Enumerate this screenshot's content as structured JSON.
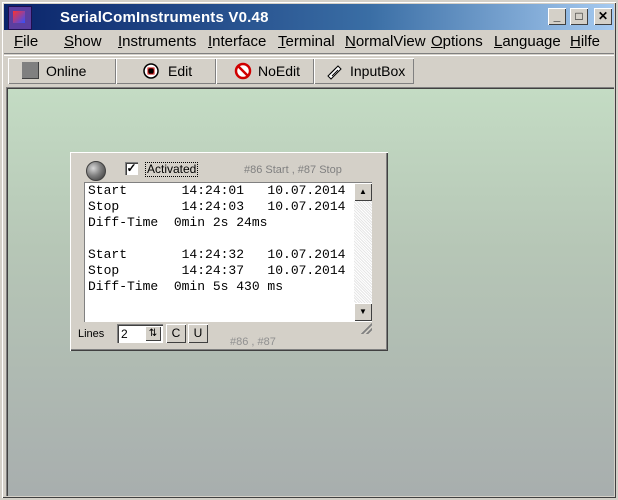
{
  "window": {
    "title": "SerialComInstruments  V0.48",
    "controls": {
      "minimize": "_",
      "maximize": "□",
      "close": "✕"
    }
  },
  "menu": [
    {
      "underline": "F",
      "rest": "ile"
    },
    {
      "underline": "S",
      "rest": "how"
    },
    {
      "underline": "I",
      "rest": "nstruments"
    },
    {
      "underline": "I",
      "rest": "nterface"
    },
    {
      "underline": "T",
      "rest": "erminal"
    },
    {
      "underline": "N",
      "rest": "ormalView"
    },
    {
      "underline": "O",
      "rest": "ptions"
    },
    {
      "underline": "L",
      "rest": "anguage"
    },
    {
      "underline": "H",
      "rest": "ilfe"
    }
  ],
  "toolbar": {
    "online": "Online",
    "edit": "Edit",
    "noedit": "NoEdit",
    "inputbox": "InputBox"
  },
  "instrument": {
    "activated_label": "Activated",
    "activated_checked": "✓",
    "topic": "#86 Start , #87 Stop",
    "log": "Start       14:24:01   10.07.2014\nStop        14:24:03   10.07.2014\nDiff-Time  0min 2s 24ms\n\nStart       14:24:32   10.07.2014\nStop        14:24:37   10.07.2014\nDiff-Time  0min 5s 430 ms",
    "scroll_up": "▲",
    "scroll_down": "▼",
    "lines_label": "Lines",
    "lines_value": "2",
    "spin": "⇅",
    "c_button": "C",
    "u_button": "U",
    "footer_topic": "#86 , #87"
  },
  "colors": {
    "titlebar_start": "#0a246a",
    "titlebar_end": "#a6caf0",
    "client_top": "#c4dcc4",
    "client_bottom": "#a8aeae",
    "online_square": "#808080",
    "noedit_icon": "#d00000"
  },
  "icons": {
    "online": "gray-square-icon",
    "edit": "edit-icon",
    "noedit": "no-edit-icon",
    "inputbox": "input-box-icon"
  }
}
